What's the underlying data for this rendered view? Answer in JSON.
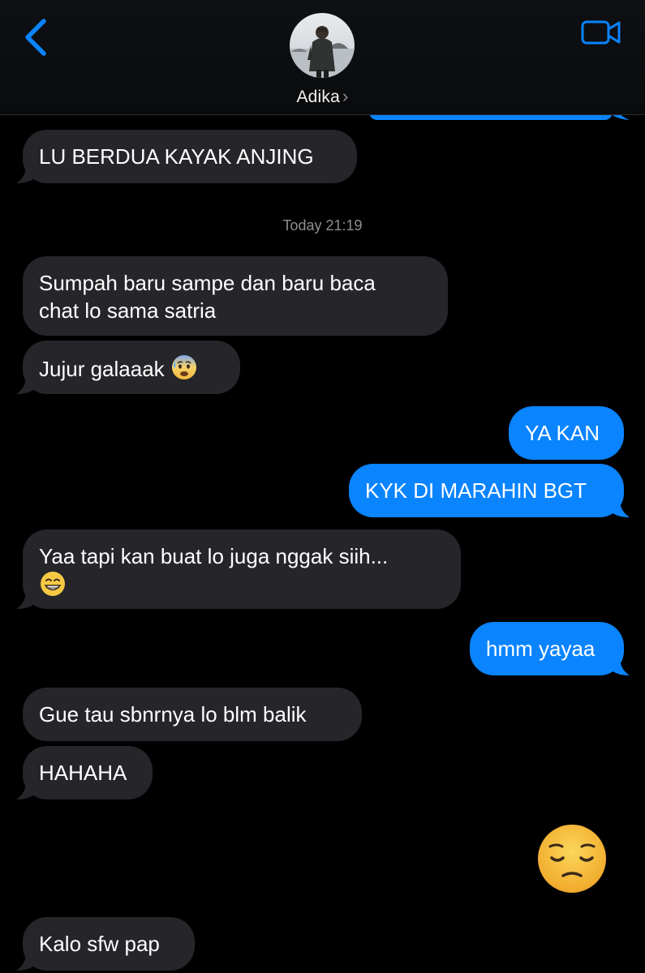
{
  "header": {
    "contact_name": "Adika",
    "chevron": "›",
    "back_icon": "chevron-left-icon",
    "video_icon": "video-camera-icon",
    "accent_color": "#0a84ff"
  },
  "timestamp": "Today 21:19",
  "messages": [
    {
      "direction": "received",
      "lines": [
        "LU BERDUA KAYAK ANJING"
      ]
    },
    {
      "direction": "received",
      "lines": [
        "Sumpah baru sampe dan baru baca",
        "chat lo sama satria"
      ]
    },
    {
      "direction": "received",
      "lines": [
        "Jujur galaaak"
      ],
      "emoji": "anxious-face-with-sweat"
    },
    {
      "direction": "sent",
      "lines": [
        "YA KAN"
      ]
    },
    {
      "direction": "sent",
      "lines": [
        "KYK DI MARAHIN BGT"
      ]
    },
    {
      "direction": "received",
      "lines": [
        "Yaa tapi kan buat lo juga nggak siih..."
      ],
      "emoji": "grinning-face"
    },
    {
      "direction": "sent",
      "lines": [
        "hmm yayaa"
      ]
    },
    {
      "direction": "received",
      "lines": [
        "Gue tau sbnrnya lo blm balik"
      ]
    },
    {
      "direction": "received",
      "lines": [
        "HAHAHA"
      ]
    },
    {
      "direction": "sent",
      "emoji": "pensive-face"
    },
    {
      "direction": "received",
      "lines": [
        "Kalo sfw pap"
      ]
    }
  ],
  "colors": {
    "received_bubble": "#26252a",
    "sent_bubble": "#0a84ff",
    "background": "#000000"
  }
}
